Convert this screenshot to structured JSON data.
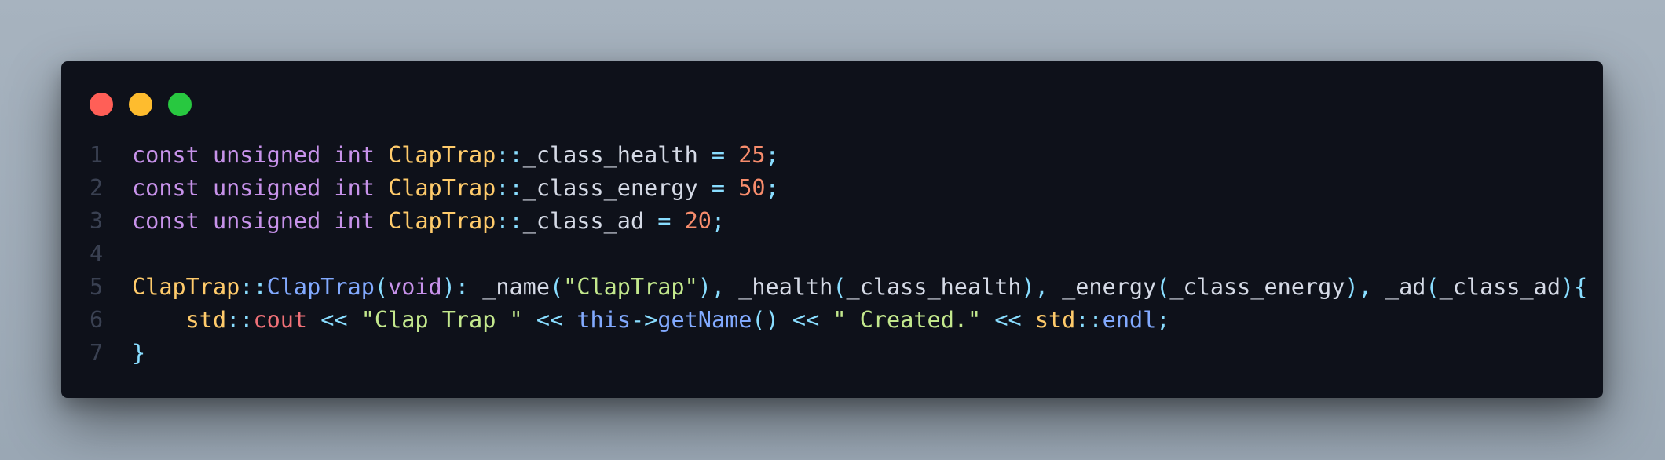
{
  "colors": {
    "background": "#a7b3bf",
    "window_bg": "#0e111a",
    "dot_close": "#ff5f57",
    "dot_minimize": "#febc2e",
    "dot_maximize": "#28c840",
    "line_number": "#3a4152",
    "plain": "#d5dae6",
    "keyword": "#c792ea",
    "class": "#ffcb6b",
    "operator": "#89ddff",
    "number": "#f78c6c",
    "string": "#c3e88d",
    "function": "#82aaff",
    "variable": "#f07178"
  },
  "window": {
    "dots": [
      "close-dot",
      "minimize-dot",
      "maximize-dot"
    ]
  },
  "code": {
    "lines": [
      {
        "number": "1",
        "tokens": [
          {
            "text": "const",
            "type": "keyword"
          },
          {
            "text": " ",
            "type": "plain"
          },
          {
            "text": "unsigned",
            "type": "keyword"
          },
          {
            "text": " ",
            "type": "plain"
          },
          {
            "text": "int",
            "type": "keyword"
          },
          {
            "text": " ",
            "type": "plain"
          },
          {
            "text": "ClapTrap",
            "type": "class"
          },
          {
            "text": "::",
            "type": "operator"
          },
          {
            "text": "_class_health",
            "type": "plain"
          },
          {
            "text": " ",
            "type": "plain"
          },
          {
            "text": "=",
            "type": "operator"
          },
          {
            "text": " ",
            "type": "plain"
          },
          {
            "text": "25",
            "type": "number"
          },
          {
            "text": ";",
            "type": "operator"
          }
        ]
      },
      {
        "number": "2",
        "tokens": [
          {
            "text": "const",
            "type": "keyword"
          },
          {
            "text": " ",
            "type": "plain"
          },
          {
            "text": "unsigned",
            "type": "keyword"
          },
          {
            "text": " ",
            "type": "plain"
          },
          {
            "text": "int",
            "type": "keyword"
          },
          {
            "text": " ",
            "type": "plain"
          },
          {
            "text": "ClapTrap",
            "type": "class"
          },
          {
            "text": "::",
            "type": "operator"
          },
          {
            "text": "_class_energy",
            "type": "plain"
          },
          {
            "text": " ",
            "type": "plain"
          },
          {
            "text": "=",
            "type": "operator"
          },
          {
            "text": " ",
            "type": "plain"
          },
          {
            "text": "50",
            "type": "number"
          },
          {
            "text": ";",
            "type": "operator"
          }
        ]
      },
      {
        "number": "3",
        "tokens": [
          {
            "text": "const",
            "type": "keyword"
          },
          {
            "text": " ",
            "type": "plain"
          },
          {
            "text": "unsigned",
            "type": "keyword"
          },
          {
            "text": " ",
            "type": "plain"
          },
          {
            "text": "int",
            "type": "keyword"
          },
          {
            "text": " ",
            "type": "plain"
          },
          {
            "text": "ClapTrap",
            "type": "class"
          },
          {
            "text": "::",
            "type": "operator"
          },
          {
            "text": "_class_ad",
            "type": "plain"
          },
          {
            "text": " ",
            "type": "plain"
          },
          {
            "text": "=",
            "type": "operator"
          },
          {
            "text": " ",
            "type": "plain"
          },
          {
            "text": "20",
            "type": "number"
          },
          {
            "text": ";",
            "type": "operator"
          }
        ]
      },
      {
        "number": "4",
        "tokens": []
      },
      {
        "number": "5",
        "tokens": [
          {
            "text": "ClapTrap",
            "type": "class"
          },
          {
            "text": "::",
            "type": "operator"
          },
          {
            "text": "ClapTrap",
            "type": "function"
          },
          {
            "text": "(",
            "type": "operator"
          },
          {
            "text": "void",
            "type": "keyword"
          },
          {
            "text": "):",
            "type": "operator"
          },
          {
            "text": " _name",
            "type": "plain"
          },
          {
            "text": "(",
            "type": "operator"
          },
          {
            "text": "\"ClapTrap\"",
            "type": "string"
          },
          {
            "text": "),",
            "type": "operator"
          },
          {
            "text": " _health",
            "type": "plain"
          },
          {
            "text": "(",
            "type": "operator"
          },
          {
            "text": "_class_health",
            "type": "plain"
          },
          {
            "text": "),",
            "type": "operator"
          },
          {
            "text": " _energy",
            "type": "plain"
          },
          {
            "text": "(",
            "type": "operator"
          },
          {
            "text": "_class_energy",
            "type": "plain"
          },
          {
            "text": "),",
            "type": "operator"
          },
          {
            "text": " _ad",
            "type": "plain"
          },
          {
            "text": "(",
            "type": "operator"
          },
          {
            "text": "_class_ad",
            "type": "plain"
          },
          {
            "text": "){",
            "type": "operator"
          }
        ]
      },
      {
        "number": "6",
        "tokens": [
          {
            "text": "    ",
            "type": "plain"
          },
          {
            "text": "std",
            "type": "class"
          },
          {
            "text": "::",
            "type": "operator"
          },
          {
            "text": "cout",
            "type": "variable"
          },
          {
            "text": " ",
            "type": "plain"
          },
          {
            "text": "<<",
            "type": "operator"
          },
          {
            "text": " ",
            "type": "plain"
          },
          {
            "text": "\"Clap Trap \"",
            "type": "string"
          },
          {
            "text": " ",
            "type": "plain"
          },
          {
            "text": "<<",
            "type": "operator"
          },
          {
            "text": " ",
            "type": "plain"
          },
          {
            "text": "this",
            "type": "function"
          },
          {
            "text": "->",
            "type": "operator"
          },
          {
            "text": "getName",
            "type": "function"
          },
          {
            "text": "()",
            "type": "operator"
          },
          {
            "text": " ",
            "type": "plain"
          },
          {
            "text": "<<",
            "type": "operator"
          },
          {
            "text": " ",
            "type": "plain"
          },
          {
            "text": "\" Created.\"",
            "type": "string"
          },
          {
            "text": " ",
            "type": "plain"
          },
          {
            "text": "<<",
            "type": "operator"
          },
          {
            "text": " ",
            "type": "plain"
          },
          {
            "text": "std",
            "type": "class"
          },
          {
            "text": "::",
            "type": "operator"
          },
          {
            "text": "endl",
            "type": "function"
          },
          {
            "text": ";",
            "type": "operator"
          }
        ]
      },
      {
        "number": "7",
        "tokens": [
          {
            "text": "}",
            "type": "operator"
          }
        ]
      }
    ]
  }
}
